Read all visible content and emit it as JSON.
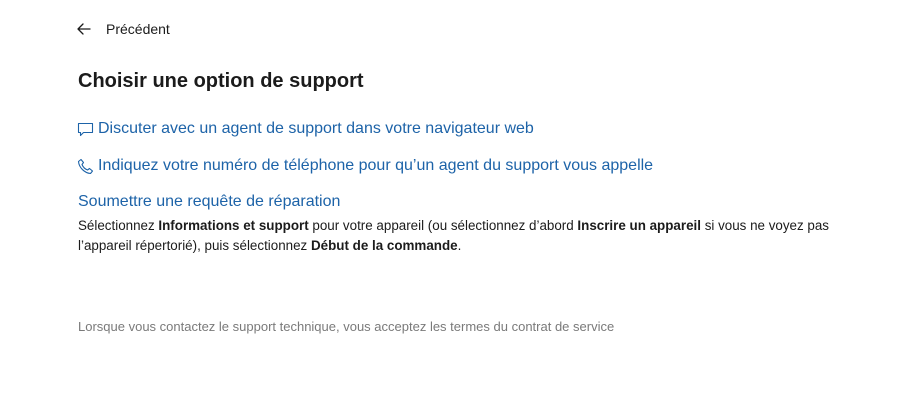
{
  "nav": {
    "back_label": "Précédent"
  },
  "page": {
    "title": "Choisir une option de support"
  },
  "options": {
    "chat_label": "Discuter avec un agent de support dans votre navigateur web",
    "phone_label": "Indiquez votre numéro de téléphone pour qu’un agent du support vous appelle",
    "repair_label": "Soumettre une requête de réparation"
  },
  "repair_description": {
    "part1": "Sélectionnez ",
    "bold1": "Informations et support",
    "part2": " pour votre appareil (ou sélectionnez d’abord ",
    "bold2": "Inscrire un appareil",
    "part3": " si vous ne voyez pas l’appareil répertorié), puis sélectionnez ",
    "bold3": "Début de la commande",
    "part4": "."
  },
  "footer": {
    "terms_text": "Lorsque vous contactez le support technique, vous acceptez les termes du contrat de service"
  },
  "colors": {
    "link": "#1d63a8",
    "text": "#1b1b1b",
    "muted": "#7a7a7a",
    "background": "#ffffff"
  },
  "icons": {
    "back": "arrow-left-icon",
    "chat": "chat-bubble-icon",
    "phone": "phone-icon"
  }
}
